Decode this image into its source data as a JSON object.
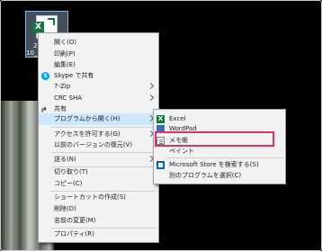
{
  "desktop": {
    "icon_label_line1": "2",
    "icon_label_line2": "10_1",
    "excel_badge": "X"
  },
  "context_menu": {
    "items": [
      {
        "label": "開く(O)"
      },
      {
        "label": "印刷(P)"
      },
      {
        "label": "編集(E)"
      },
      {
        "label": "Skype で共有",
        "icon": "skype-icon"
      },
      {
        "label": "7-Zip",
        "submenu": true
      },
      {
        "label": "CRC SHA",
        "submenu": true
      },
      {
        "label": "共有",
        "icon": "share-icon"
      },
      {
        "label": "プログラムから開く(H)",
        "submenu": true
      },
      {
        "label": "アクセスを許可する(G)",
        "submenu": true
      },
      {
        "label": "以前のバージョンの復元(V)"
      },
      {
        "label": "送る(N)",
        "submenu": true
      },
      {
        "label": "切り取り(T)"
      },
      {
        "label": "コピー(C)"
      },
      {
        "label": "ショートカットの作成(S)"
      },
      {
        "label": "削除(D)"
      },
      {
        "label": "名前の変更(M)"
      },
      {
        "label": "プロパティ(R)"
      }
    ]
  },
  "open_with_submenu": {
    "items": [
      {
        "label": "Excel",
        "icon": "excel-icon"
      },
      {
        "label": "WordPad",
        "icon": "wordpad-icon"
      },
      {
        "label": "メモ帳",
        "icon": "notepad-icon",
        "highlighted": true
      },
      {
        "label": "ペイント",
        "icon": "paint-icon"
      },
      {
        "label": "Microsoft Store を検索する(S)",
        "icon": "store-icon"
      },
      {
        "label": "別のプログラムを選択(C)"
      }
    ]
  },
  "colors": {
    "highlight_border": "#e0306a",
    "hover_background": "#cce8ff",
    "excel_green": "#1e7145"
  }
}
